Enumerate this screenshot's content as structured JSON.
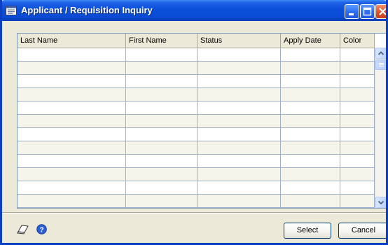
{
  "window": {
    "title": "Applicant / Requisition Inquiry"
  },
  "grid": {
    "columns": [
      "Last Name",
      "First Name",
      "Status",
      "Apply Date",
      "Color"
    ],
    "rows": [
      [
        "",
        "",
        "",
        "",
        ""
      ],
      [
        "",
        "",
        "",
        "",
        ""
      ],
      [
        "",
        "",
        "",
        "",
        ""
      ],
      [
        "",
        "",
        "",
        "",
        ""
      ],
      [
        "",
        "",
        "",
        "",
        ""
      ],
      [
        "",
        "",
        "",
        "",
        ""
      ],
      [
        "",
        "",
        "",
        "",
        ""
      ],
      [
        "",
        "",
        "",
        "",
        ""
      ],
      [
        "",
        "",
        "",
        "",
        ""
      ],
      [
        "",
        "",
        "",
        "",
        ""
      ],
      [
        "",
        "",
        "",
        "",
        ""
      ],
      [
        "",
        "",
        "",
        "",
        ""
      ]
    ]
  },
  "footer": {
    "select_label": "Select",
    "cancel_label": "Cancel",
    "icons": [
      "note-icon",
      "help-icon"
    ]
  },
  "colors": {
    "title_bar": "#0a4bd3",
    "window_bg": "#ece9d8",
    "close_button": "#e0552f"
  }
}
